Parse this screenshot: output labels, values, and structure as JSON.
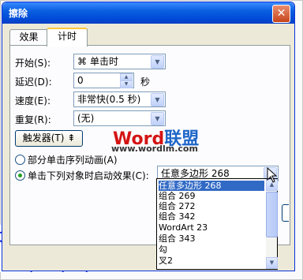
{
  "window": {
    "title": "擦除",
    "close_glyph": "✕"
  },
  "tabs": [
    {
      "label": "效果"
    },
    {
      "label": "计时"
    }
  ],
  "form": {
    "start_label": "开始(S):",
    "start_value": "单击时",
    "delay_label": "延迟(D):",
    "delay_value": "0",
    "delay_unit": "秒",
    "speed_label": "速度(E):",
    "speed_value": "非常快(0.5 秒)",
    "repeat_label": "重复(R):",
    "repeat_value": "(无)",
    "trigger_button": "触发器(T) ⇞",
    "radio1_label": "部分单击序列动画(A)",
    "radio2_label": "单击下列对象时启动效果(C):",
    "object_value": "任意多边形 268"
  },
  "watermark": {
    "brand_red": "Word",
    "brand_blue": "联盟",
    "url": "www.wordlm.com"
  },
  "object_list": [
    "任意多边形 268",
    "组合 269",
    "组合 272",
    "组合 342",
    "WordArt 23",
    "组合 343",
    "勾",
    "叉2"
  ],
  "colors": {
    "title_bar": "#0a5ee0",
    "selection": "#316ac5",
    "watermark_red": "#d41414",
    "watermark_blue": "#1e66c8"
  }
}
